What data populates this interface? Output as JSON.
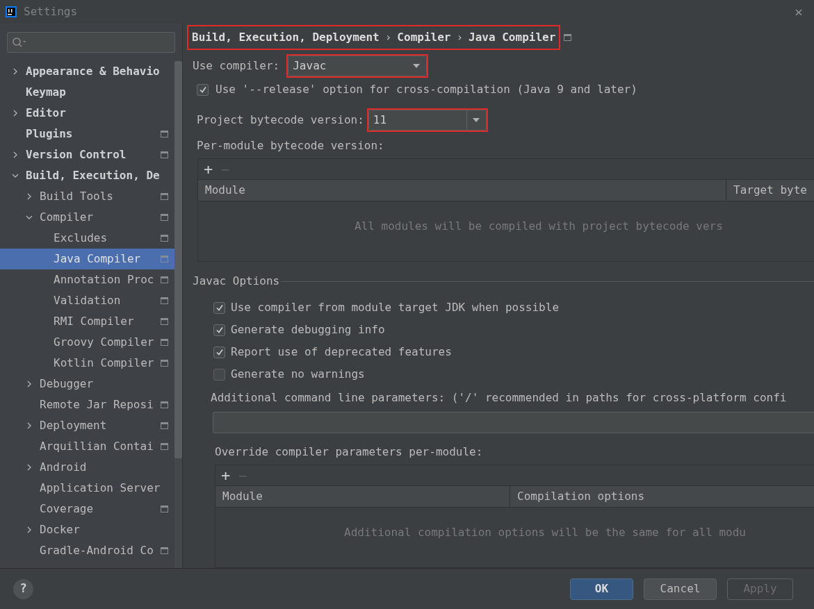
{
  "window": {
    "title": "Settings",
    "close": "×"
  },
  "sidebar": {
    "items": [
      {
        "label": "Appearance & Behavio",
        "kind": "folder",
        "expanded": false,
        "project_level": false,
        "selected": false
      },
      {
        "label": "Keymap",
        "kind": "leaf",
        "project_level": false,
        "selected": false
      },
      {
        "label": "Editor",
        "kind": "folder",
        "expanded": false,
        "project_level": false,
        "selected": false
      },
      {
        "label": "Plugins",
        "kind": "leaf",
        "project_level": true,
        "selected": false
      },
      {
        "label": "Version Control",
        "kind": "folder",
        "expanded": false,
        "project_level": true,
        "selected": false
      },
      {
        "label": "Build, Execution, De",
        "kind": "folder",
        "expanded": true,
        "project_level": false,
        "selected": false,
        "children": [
          {
            "label": "Build Tools",
            "kind": "folder",
            "expanded": false,
            "project_level": true,
            "selected": false
          },
          {
            "label": "Compiler",
            "kind": "folder",
            "expanded": true,
            "project_level": true,
            "selected": false,
            "children": [
              {
                "label": "Excludes",
                "kind": "leaf",
                "project_level": true,
                "selected": false
              },
              {
                "label": "Java Compiler",
                "kind": "leaf",
                "project_level": true,
                "selected": true
              },
              {
                "label": "Annotation Proc",
                "kind": "leaf",
                "project_level": true,
                "selected": false
              },
              {
                "label": "Validation",
                "kind": "leaf",
                "project_level": true,
                "selected": false
              },
              {
                "label": "RMI Compiler",
                "kind": "leaf",
                "project_level": true,
                "selected": false
              },
              {
                "label": "Groovy Compiler",
                "kind": "leaf",
                "project_level": true,
                "selected": false
              },
              {
                "label": "Kotlin Compiler",
                "kind": "leaf",
                "project_level": true,
                "selected": false
              }
            ]
          },
          {
            "label": "Debugger",
            "kind": "folder",
            "expanded": false,
            "project_level": false,
            "selected": false
          },
          {
            "label": "Remote Jar Reposi",
            "kind": "leaf",
            "project_level": true,
            "selected": false
          },
          {
            "label": "Deployment",
            "kind": "folder",
            "expanded": false,
            "project_level": true,
            "selected": false
          },
          {
            "label": "Arquillian Contai",
            "kind": "leaf",
            "project_level": true,
            "selected": false
          },
          {
            "label": "Android",
            "kind": "folder",
            "expanded": false,
            "project_level": false,
            "selected": false
          },
          {
            "label": "Application Server",
            "kind": "leaf",
            "project_level": false,
            "selected": false
          },
          {
            "label": "Coverage",
            "kind": "leaf",
            "project_level": true,
            "selected": false
          },
          {
            "label": "Docker",
            "kind": "folder",
            "expanded": false,
            "project_level": false,
            "selected": false
          },
          {
            "label": "Gradle-Android Co",
            "kind": "leaf",
            "project_level": true,
            "selected": false
          }
        ]
      }
    ]
  },
  "breadcrumb": {
    "segments": [
      "Build, Execution, Deployment",
      "Compiler",
      "Java Compiler"
    ],
    "separator": "›",
    "highlighted": true
  },
  "use_compiler": {
    "label": "Use compiler:",
    "value": "Javac",
    "highlighted": true
  },
  "release_option": {
    "label": "Use '--release' option for cross-compilation (Java 9 and later)",
    "checked": true
  },
  "bytecode_version": {
    "label": "Project bytecode version:",
    "value": "11",
    "highlighted": true
  },
  "per_module": {
    "label": "Per-module bytecode version:",
    "add": "+",
    "remove": "−",
    "columns": [
      "Module",
      "Target byte"
    ],
    "empty_text": "All modules will be compiled with project bytecode vers"
  },
  "javac_options": {
    "title": "Javac Options",
    "checkboxes": [
      {
        "label": "Use compiler from module target JDK when possible",
        "checked": true
      },
      {
        "label": "Generate debugging info",
        "checked": true
      },
      {
        "label": "Report use of deprecated features",
        "checked": true
      },
      {
        "label": "Generate no warnings",
        "checked": false
      }
    ],
    "parameters": {
      "label": "Additional command line parameters: ('/' recommended in paths for cross-platform confi"
    },
    "override": {
      "label": "Override compiler parameters per-module:",
      "add": "+",
      "remove": "−",
      "columns": [
        "Module",
        "Compilation options"
      ],
      "empty_text": "Additional compilation options will be the same for all modu"
    }
  },
  "footer": {
    "help": "?",
    "buttons": [
      {
        "label": "OK",
        "kind": "default",
        "disabled": false
      },
      {
        "label": "Cancel",
        "kind": "normal",
        "disabled": false
      },
      {
        "label": "Apply",
        "kind": "normal",
        "disabled": true
      }
    ]
  }
}
